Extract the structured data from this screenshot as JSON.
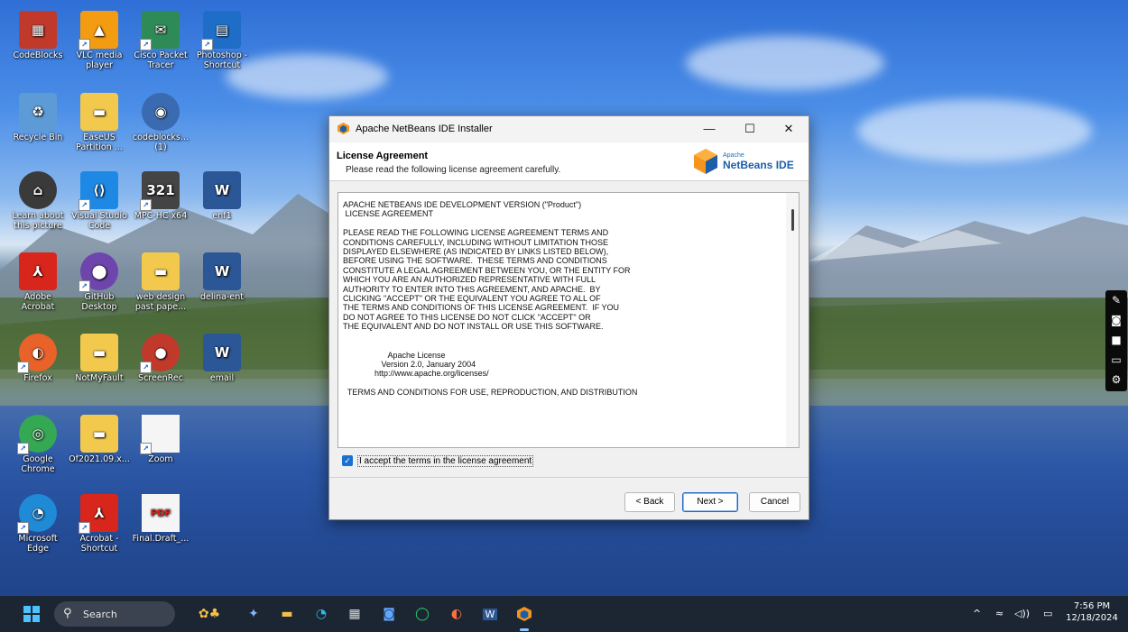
{
  "desktop": {
    "icons": [
      {
        "label": "CodeBlocks",
        "color": "#c0392b",
        "glyph": "▦"
      },
      {
        "label": "VLC media player",
        "color": "#f39c12",
        "glyph": "▲"
      },
      {
        "label": "Cisco Packet Tracer",
        "color": "#2e8b57",
        "glyph": "✉"
      },
      {
        "label": "Photoshop - Shortcut",
        "color": "#1e6ec8",
        "glyph": "▤"
      },
      {
        "label": "Recycle Bin",
        "color": "#5d9bd6",
        "glyph": "♻"
      },
      {
        "label": "EaseUS Partition ...",
        "color": "#f2c94c",
        "glyph": "▬"
      },
      {
        "label": "codeblocks... (1)",
        "color": "#3a6ab0",
        "glyph": "◉"
      },
      {
        "label": "Learn about this picture",
        "color": "#3a3a3a",
        "glyph": "⌂"
      },
      {
        "label": "Visual Studio Code",
        "color": "#1e88e5",
        "glyph": "⟨⟩"
      },
      {
        "label": "MPC-HC x64",
        "color": "#444444",
        "glyph": "321"
      },
      {
        "label": "enf1",
        "color": "#2b5797",
        "glyph": "W"
      },
      {
        "label": "Adobe Acrobat",
        "color": "#d9261c",
        "glyph": "⅄"
      },
      {
        "label": "GitHub Desktop",
        "color": "#6e44ad",
        "glyph": "⬤"
      },
      {
        "label": "web design past pape...",
        "color": "#f2c94c",
        "glyph": "▬"
      },
      {
        "label": "delina-ent",
        "color": "#2b5797",
        "glyph": "W"
      },
      {
        "label": "Firefox",
        "color": "#e8622a",
        "glyph": "◐"
      },
      {
        "label": "NotMyFault",
        "color": "#f2c94c",
        "glyph": "▬"
      },
      {
        "label": "ScreenRec",
        "color": "#c0392b",
        "glyph": "●"
      },
      {
        "label": "email",
        "color": "#2b5797",
        "glyph": "W"
      },
      {
        "label": "Google Chrome",
        "color": "#34a853",
        "glyph": "◎"
      },
      {
        "label": "Of2021.09.x...",
        "color": "#f2c94c",
        "glyph": "▬"
      },
      {
        "label": "Zoom",
        "color": "#f5f5f5",
        "glyph": ""
      },
      {
        "label": "Microsoft Edge",
        "color": "#1f8ad6",
        "glyph": "◔"
      },
      {
        "label": "Acrobat - Shortcut",
        "color": "#d9261c",
        "glyph": "⅄"
      },
      {
        "label": "Final.Draft_...",
        "color": "#f5f5f5",
        "glyph": "PDF"
      }
    ]
  },
  "dialog": {
    "title": "Apache NetBeans IDE Installer",
    "minimize": "—",
    "maximize": "☐",
    "close": "✕",
    "header_title": "License Agreement",
    "header_subtitle": "Please read the following license agreement carefully.",
    "logo_small": "Apache",
    "logo_large": "NetBeans IDE",
    "license_text": "APACHE NETBEANS IDE DEVELOPMENT VERSION (\"Product\")\n LICENSE AGREEMENT\n\nPLEASE READ THE FOLLOWING LICENSE AGREEMENT TERMS AND\nCONDITIONS CAREFULLY, INCLUDING WITHOUT LIMITATION THOSE\nDISPLAYED ELSEWHERE (AS INDICATED BY LINKS LISTED BELOW),\nBEFORE USING THE SOFTWARE.  THESE TERMS AND CONDITIONS\nCONSTITUTE A LEGAL AGREEMENT BETWEEN YOU, OR THE ENTITY FOR\nWHICH YOU ARE AN AUTHORIZED REPRESENTATIVE WITH FULL\nAUTHORITY TO ENTER INTO THIS AGREEMENT, AND APACHE.  BY\nCLICKING \"ACCEPT\" OR THE EQUIVALENT YOU AGREE TO ALL OF\nTHE TERMS AND CONDITIONS OF THIS LICENSE AGREEMENT.  IF YOU\nDO NOT AGREE TO THIS LICENSE DO NOT CLICK \"ACCEPT\" OR\nTHE EQUIVALENT AND DO NOT INSTALL OR USE THIS SOFTWARE.\n\n\n                    Apache License\n                 Version 2.0, January 2004\n              http://www.apache.org/licenses/\n\n  TERMS AND CONDITIONS FOR USE, REPRODUCTION, AND DISTRIBUTION",
    "accept_label": "I accept the terms in the license agreement",
    "accept_checked": true,
    "back_label": "< Back",
    "next_label": "Next >",
    "cancel_label": "Cancel"
  },
  "taskbar": {
    "search_placeholder": "Search",
    "time": "7:56 PM",
    "date": "12/18/2024",
    "tray_chevron": "^",
    "tray_wifi": "≈",
    "tray_volume": "◁))",
    "tray_battery": "▭"
  }
}
